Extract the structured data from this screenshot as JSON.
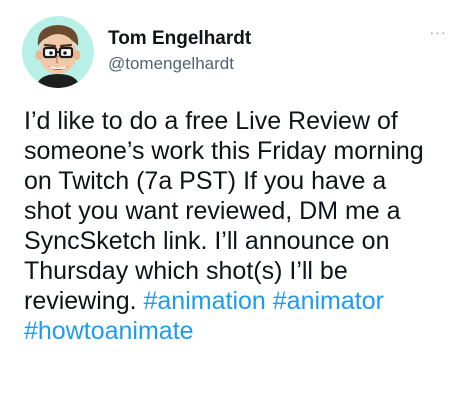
{
  "author": {
    "display_name": "Tom Engelhardt",
    "handle": "@tomengelhardt"
  },
  "more_menu": {
    "label": "···"
  },
  "tweet": {
    "lines": [
      "I’d like to do a free Live Review of",
      "someone’s work this Friday morning",
      "on Twitch (7a PST) If you have a",
      "shot you want reviewed, DM me a",
      "SyncSketch link. I’ll announce on",
      "Thursday which shot(s) I’ll be"
    ],
    "last_line_prefix": "reviewing. ",
    "hashtags": [
      "#animation",
      "#animator",
      "#howtoanimate"
    ]
  },
  "colors": {
    "text": "#0f1419",
    "secondary": "#536471",
    "link": "#1d9bf0",
    "avatar_bg": "#b8f0e8"
  }
}
